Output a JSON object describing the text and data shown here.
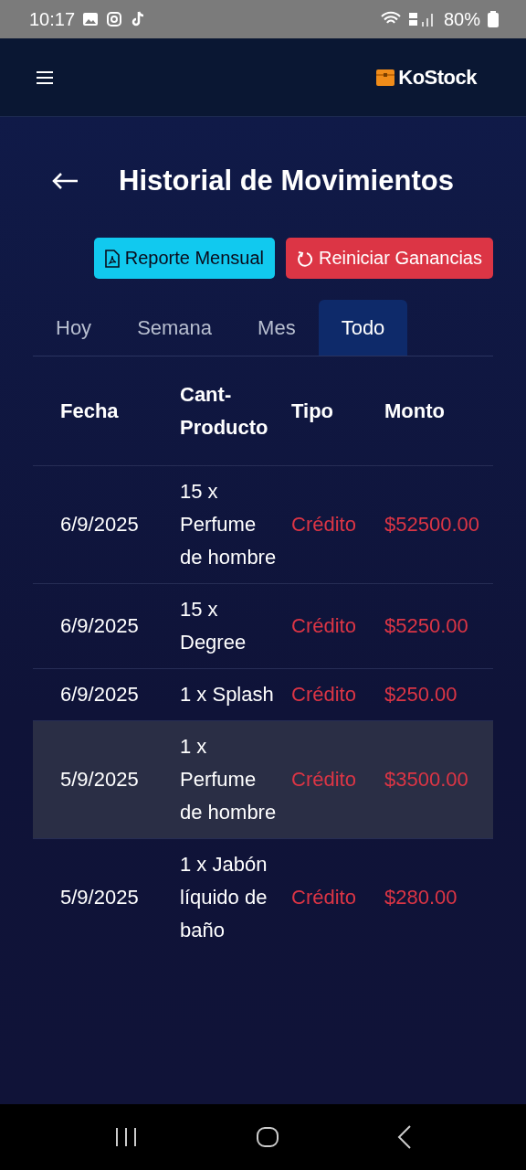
{
  "status_bar": {
    "time": "10:17",
    "battery": "80%"
  },
  "header": {
    "brand": "KoStock"
  },
  "page": {
    "title": "Historial de Movimientos"
  },
  "actions": [
    {
      "kind": "report",
      "label": "Reporte Mensual"
    },
    {
      "kind": "reset",
      "label": "Reiniciar Ganancias"
    }
  ],
  "tabs": [
    {
      "label": "Hoy",
      "selected": false
    },
    {
      "label": "Semana",
      "selected": false
    },
    {
      "label": "Mes",
      "selected": false
    },
    {
      "label": "Todo",
      "selected": true
    }
  ],
  "table": {
    "columns": [
      "Fecha",
      "Cant-Producto",
      "Tipo",
      "Monto"
    ],
    "rows": [
      {
        "date": "6/9/2025",
        "product": "15 x Perfume de hombre",
        "type": "Crédito",
        "amount": "$52500.00",
        "selected": false
      },
      {
        "date": "6/9/2025",
        "product": "15 x Degree",
        "type": "Crédito",
        "amount": "$5250.00",
        "selected": false
      },
      {
        "date": "6/9/2025",
        "product": "1 x Splash",
        "type": "Crédito",
        "amount": "$250.00",
        "selected": false
      },
      {
        "date": "5/9/2025",
        "product": "1 x Perfume de hombre",
        "type": "Crédito",
        "amount": "$3500.00",
        "selected": true
      },
      {
        "date": "5/9/2025",
        "product": "1 x Jabón líquido de baño",
        "type": "Crédito",
        "amount": "$280.00",
        "selected": false
      }
    ]
  }
}
